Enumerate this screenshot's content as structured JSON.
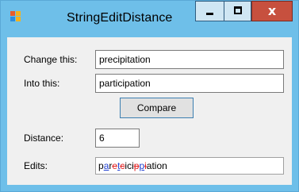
{
  "window": {
    "title": "StringEditDistance"
  },
  "icons": {
    "app": "app-icon",
    "minimize": "minimize-icon",
    "maximize": "maximize-icon",
    "close": "close-icon"
  },
  "titlebar_buttons": {
    "close_glyph": "x"
  },
  "form": {
    "change_label": "Change this:",
    "change_value": "precipitation",
    "into_label": "Into this:",
    "into_value": "participation",
    "compare_label": "Compare",
    "distance_label": "Distance:",
    "distance_value": "6",
    "edits_label": "Edits:"
  },
  "edits": [
    {
      "text": "p",
      "op": "keep"
    },
    {
      "text": "a",
      "op": "insert"
    },
    {
      "text": "r",
      "op": "keep"
    },
    {
      "text": "e",
      "op": "delete"
    },
    {
      "text": "t",
      "op": "insert"
    },
    {
      "text": "c",
      "op": "delete"
    },
    {
      "text": "ici",
      "op": "keep"
    },
    {
      "text": "p",
      "op": "delete"
    },
    {
      "text": "p",
      "op": "insert"
    },
    {
      "text": "i",
      "op": "delete"
    },
    {
      "text": "ation",
      "op": "keep"
    }
  ],
  "colors": {
    "window_frame": "#6ebfe9",
    "client_bg": "#f0f0f0",
    "close_button": "#c7503e",
    "deleted_text": "#e02020",
    "inserted_text": "#1f3fd0"
  }
}
